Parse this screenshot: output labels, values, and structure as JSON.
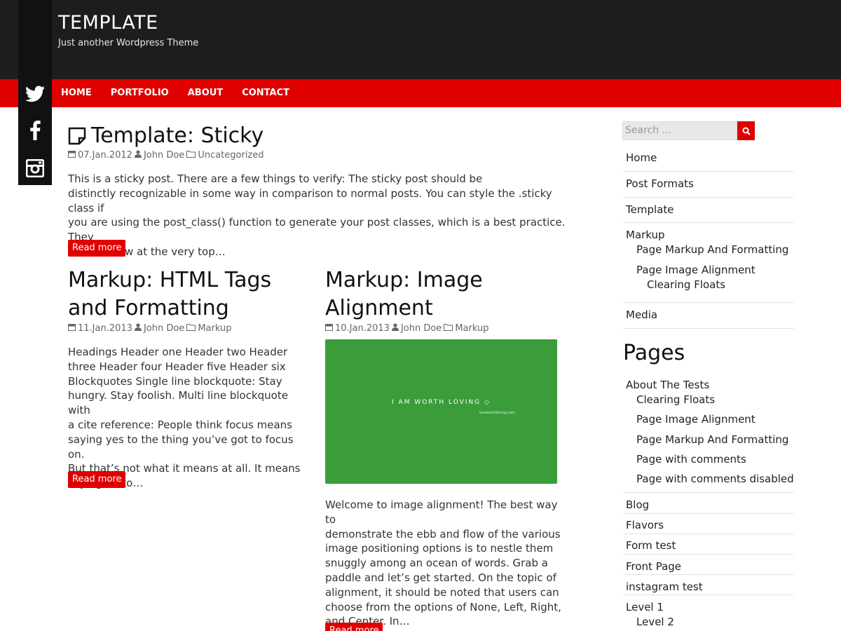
{
  "site": {
    "title": "TEMPLATE",
    "description": "Just another Wordpress Theme"
  },
  "nav": [
    "HOME",
    "PORTFOLIO",
    "ABOUT",
    "CONTACT"
  ],
  "social": [
    "twitter-icon",
    "facebook-icon",
    "instagram-icon"
  ],
  "colors": {
    "accent": "#e10000",
    "header": "#1d1d1d",
    "image_green": "#3a9d3a"
  },
  "sticky": {
    "title": "Template: Sticky",
    "date": "07.Jan.2012",
    "author": "John Doe",
    "category": "Uncategorized",
    "excerpt": [
      "This is a sticky post. There are a few things to verify: The sticky post should be",
      "distinctly recognizable in some way in comparison to normal posts. You can style the .sticky class if",
      "you are using the post_class() function to generate your post classes, which is a best practice. They",
      "should show at the very top…"
    ],
    "read_more": "Read more"
  },
  "post_left": {
    "title": [
      "Markup: HTML Tags",
      "and Formatting"
    ],
    "date": "11.Jan.2013",
    "author": "John Doe",
    "category": "Markup",
    "excerpt": [
      "Headings Header one Header two Header",
      "three Header four Header five Header six",
      "Blockquotes Single line blockquote: Stay",
      "hungry. Stay foolish. Multi line blockquote with",
      "a cite reference: People think focus means",
      "saying yes to the thing you’ve got to focus on.",
      "But that’s not what it means at all. It means",
      "saying no to…"
    ],
    "read_more": "Read more"
  },
  "post_right": {
    "title": [
      "Markup: Image",
      "Alignment"
    ],
    "date": "10.Jan.2013",
    "author": "John Doe",
    "category": "Markup",
    "image_text": "I AM WORTH LOVING",
    "image_subtext": "iamworthloving.com",
    "excerpt": [
      "Welcome to image alignment! The best way to",
      "demonstrate the ebb and flow of the various",
      "image positioning options is to nestle them",
      "snuggly among an ocean of words. Grab a",
      "paddle and let’s get started. On the topic of",
      "alignment, it should be noted that users can",
      "choose from the options of None, Left, Right,",
      "and Center. In…"
    ],
    "read_more": "Read more"
  },
  "sidebar": {
    "search_placeholder": "Search …",
    "categories": {
      "home": "Home",
      "post_formats": "Post Formats",
      "template": "Template",
      "markup": "Markup",
      "page_markup": "Page Markup And Formatting",
      "page_image": "Page Image Alignment",
      "clearing_floats": "Clearing Floats",
      "media": "Media"
    },
    "pages_heading": "Pages",
    "pages": {
      "about": "About The Tests",
      "clearing_floats": "Clearing Floats",
      "page_image": "Page Image Alignment",
      "page_markup": "Page Markup And Formatting",
      "with_comments": "Page with comments",
      "comments_disabled": "Page with comments disabled",
      "blog": "Blog",
      "flavors": "Flavors",
      "form_test": "Form test",
      "front_page": "Front Page",
      "instagram_test": "instagram test",
      "level1": "Level 1",
      "level2": "Level 2"
    }
  }
}
